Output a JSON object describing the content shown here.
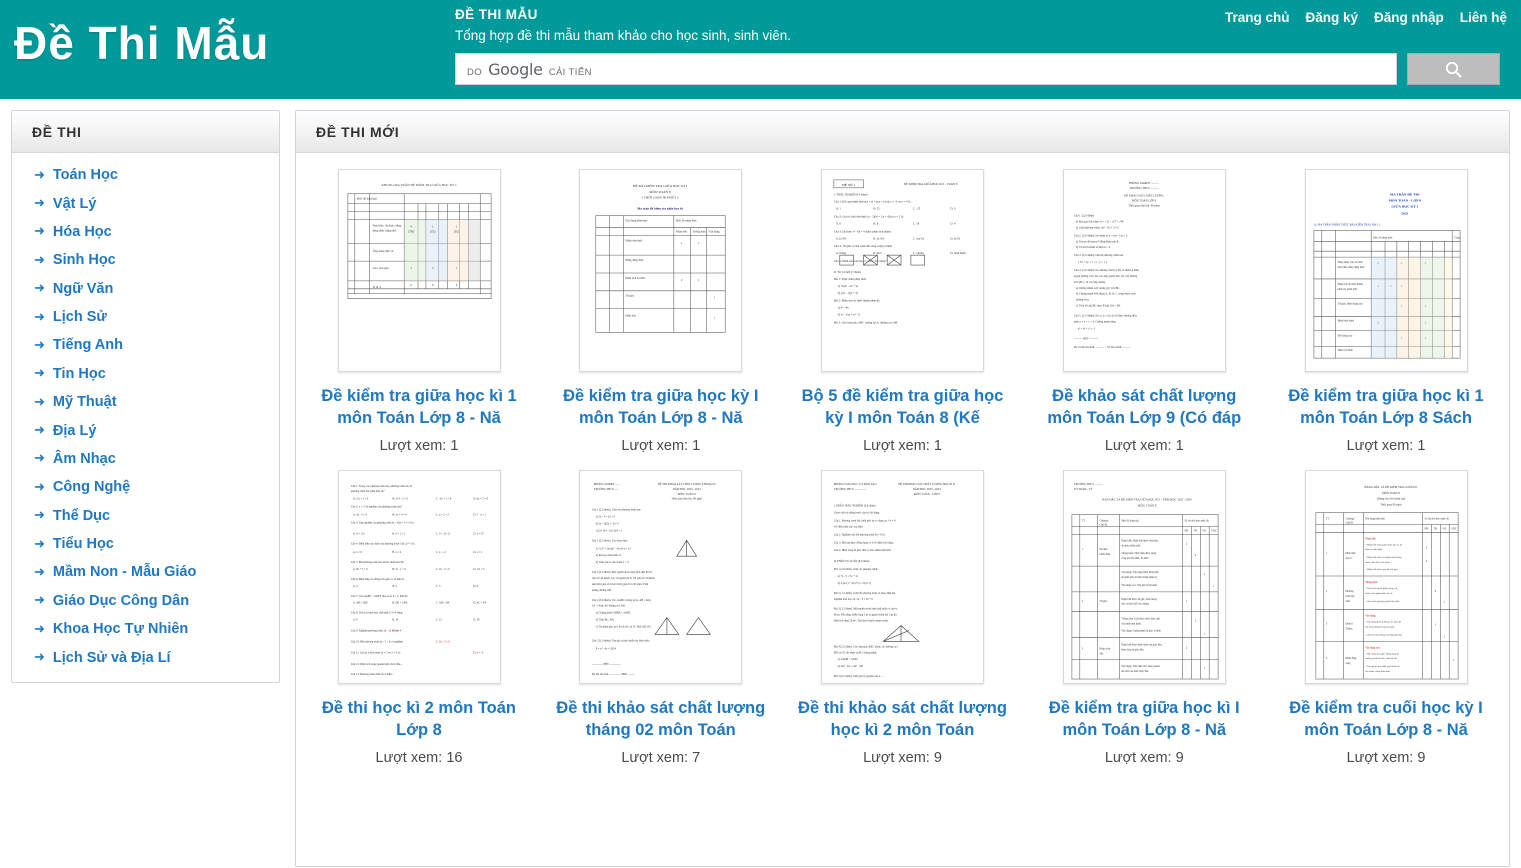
{
  "header": {
    "brand_title": "Đề Thi Mẫu",
    "site_name": "ĐỀ THI MẪU",
    "tagline": "Tổng hợp đề thi mẫu tham khảo cho học sinh, sinh viên.",
    "search": {
      "branding_do": "DO",
      "branding_google": "Google",
      "branding_improved": "CẢI TIẾN",
      "placeholder": "",
      "value": "",
      "button_icon": "search-icon"
    },
    "nav": [
      {
        "label": "Trang chủ"
      },
      {
        "label": "Đăng ký"
      },
      {
        "label": "Đăng nhập"
      },
      {
        "label": "Liên hệ"
      }
    ],
    "accent_color": "#019999"
  },
  "sidebar": {
    "title": "ĐỀ THI",
    "bullet_icon": "arrow-right-icon",
    "link_color": "#1f78c1",
    "items": [
      {
        "label": "Toán Học"
      },
      {
        "label": "Vật Lý"
      },
      {
        "label": "Hóa Học"
      },
      {
        "label": "Sinh Học"
      },
      {
        "label": "Ngữ Văn"
      },
      {
        "label": "Lịch Sử"
      },
      {
        "label": "Tiếng Anh"
      },
      {
        "label": "Tin Học"
      },
      {
        "label": "Mỹ Thuật"
      },
      {
        "label": "Địa Lý"
      },
      {
        "label": "Âm Nhạc"
      },
      {
        "label": "Công Nghệ"
      },
      {
        "label": "Thể Dục"
      },
      {
        "label": "Tiểu Học"
      },
      {
        "label": "Mầm Non - Mẫu Giáo"
      },
      {
        "label": "Giáo Dục Công Dân"
      },
      {
        "label": "Khoa Học Tự Nhiên"
      },
      {
        "label": "Lịch Sử và Địa Lí"
      }
    ]
  },
  "main": {
    "title": "ĐỀ THI MỚI",
    "views_prefix": "Lượt xem:",
    "rows": [
      {
        "cards": [
          {
            "title": "Đề kiểm tra giữa học kì 1 môn Toán Lớp 8 - Nă",
            "views": "Lượt xem: 1",
            "thumb": "matrix-table"
          },
          {
            "title": "Đề kiểm tra giữa học kỳ I môn Toán Lớp 8 - Nă",
            "views": "Lượt xem: 1",
            "thumb": "simple-table"
          },
          {
            "title": "Bộ 5 đề kiểm tra giữa học kỳ I môn Toán 8 (Kế",
            "views": "Lượt xem: 1",
            "thumb": "exam-text"
          },
          {
            "title": "Đề khảo sát chất lượng môn Toán Lớp 9 (Có đáp",
            "views": "Lượt xem: 1",
            "thumb": "dense-text"
          },
          {
            "title": "Đề kiểm tra giữa học kì 1 môn Toán Lớp 8 Sách",
            "views": "Lượt xem: 1",
            "thumb": "blue-matrix"
          }
        ]
      },
      {
        "cards": [
          {
            "title": "Đề thi học kì 2 môn Toán Lớp 8",
            "views": "Lượt xem: 16",
            "thumb": "mcq-text"
          },
          {
            "title": "Đề thi khảo sát chất lượng tháng 02 môn Toán",
            "views": "Lượt xem: 7",
            "thumb": "geometry-text"
          },
          {
            "title": "Đề thi khảo sát chất lượng học kì 2 môn Toán",
            "views": "Lượt xem: 9",
            "thumb": "plain-text"
          },
          {
            "title": "Đề kiểm tra giữa học kì I môn Toán Lớp 8 - Nă",
            "views": "Lượt xem: 9",
            "thumb": "grid-table"
          },
          {
            "title": "Đề kiểm tra cuối học kỳ I môn Toán Lớp 8 - Nă",
            "views": "Lượt xem: 9",
            "thumb": "red-table"
          }
        ]
      }
    ]
  }
}
